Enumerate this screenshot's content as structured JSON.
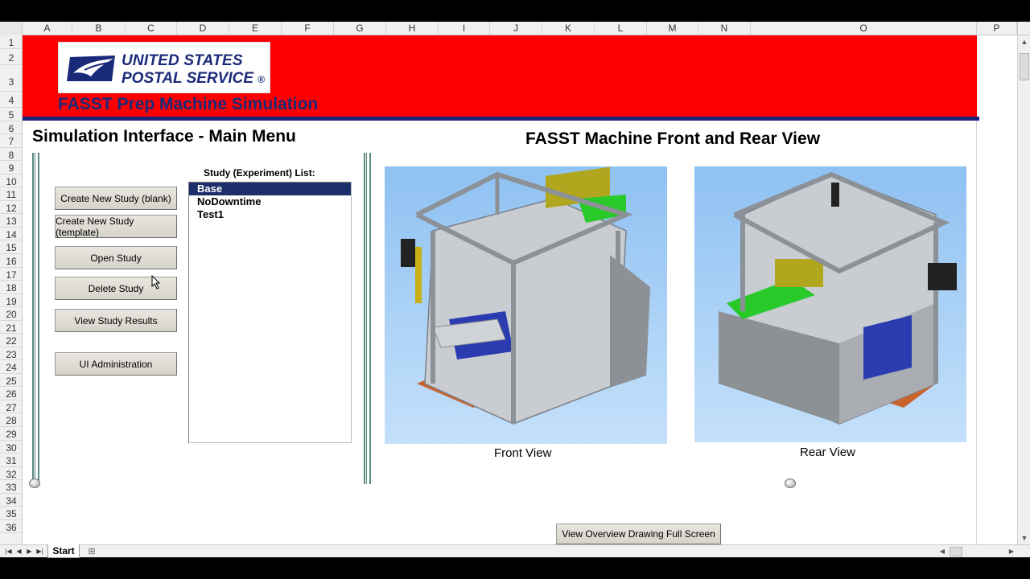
{
  "columns": [
    "A",
    "B",
    "C",
    "D",
    "E",
    "F",
    "G",
    "H",
    "I",
    "J",
    "K",
    "L",
    "M",
    "N",
    "O",
    "P"
  ],
  "rows": [
    "1",
    "2",
    "3",
    "4",
    "5",
    "6",
    "7",
    "8",
    "9",
    "10",
    "11",
    "12",
    "13",
    "14",
    "15",
    "16",
    "17",
    "18",
    "19",
    "20",
    "21",
    "22",
    "23",
    "24",
    "25",
    "26",
    "27",
    "28",
    "29",
    "30",
    "31",
    "32",
    "33",
    "34",
    "35",
    "36"
  ],
  "header": {
    "logo_line1": "UNITED STATES",
    "logo_line2": "POSTAL SERVICE",
    "logo_mark": "®",
    "app_title": "FASST Prep Machine Simulation",
    "brand_color": "#fb0000",
    "accent_color": "#1a237e"
  },
  "main_menu": {
    "title": "Simulation Interface - Main Menu",
    "buttons": [
      "Create New Study (blank)",
      "Create New Study (template)",
      "Open Study",
      "Delete Study",
      "View Study Results",
      "UI Administration"
    ]
  },
  "study_list": {
    "label": "Study (Experiment) List:",
    "items": [
      "Base",
      "NoDowntime",
      "Test1"
    ],
    "selected": "Base"
  },
  "machine_view": {
    "title": "FASST Machine Front and Rear View",
    "front_caption": "Front View",
    "rear_caption": "Rear View",
    "overview_button": "View Overview Drawing Full Screen"
  },
  "sheet_tabs": [
    "Start"
  ],
  "icons": [
    "sheet-first-icon",
    "sheet-prev-icon",
    "sheet-next-icon",
    "sheet-last-icon",
    "new-sheet-icon",
    "scroll-up-icon",
    "scroll-down-icon",
    "scroll-left-icon",
    "scroll-right-icon"
  ]
}
